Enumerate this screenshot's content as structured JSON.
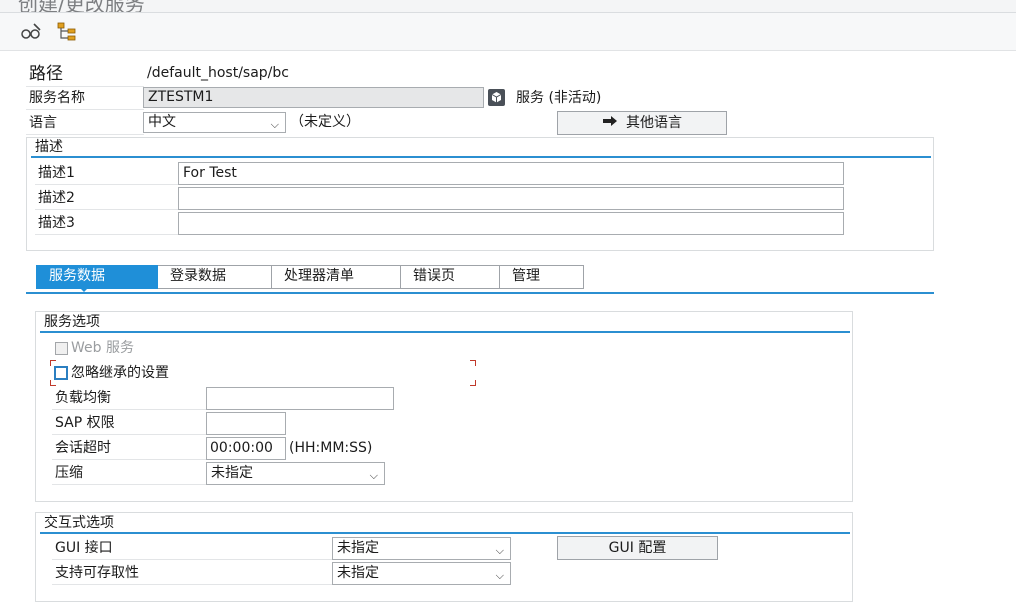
{
  "window": {
    "title": "创建/更改服务"
  },
  "toolbar": {
    "icons": [
      "glasses-edit-icon",
      "hierarchy-icon"
    ]
  },
  "header": {
    "path_label": "路径",
    "path_value": "/default_host/sap/bc",
    "service_name_label": "服务名称",
    "service_name_value": "ZTESTM1",
    "service_status": "服务 (非活动)",
    "language_label": "语言",
    "language_value": "中文",
    "language_undefined": "（未定义）",
    "other_languages_button": "其他语言"
  },
  "description": {
    "title": "描述",
    "rows": [
      {
        "label": "描述1",
        "value": "For Test"
      },
      {
        "label": "描述2",
        "value": ""
      },
      {
        "label": "描述3",
        "value": ""
      }
    ]
  },
  "tabs": [
    {
      "label": "服务数据",
      "active": true
    },
    {
      "label": "登录数据",
      "active": false
    },
    {
      "label": "处理器清单",
      "active": false
    },
    {
      "label": "错误页",
      "active": false
    },
    {
      "label": "管理",
      "active": false
    }
  ],
  "service_options": {
    "title": "服务选项",
    "web_service_label": "Web 服务",
    "ignore_inherit_label": "忽略继承的设置",
    "load_balance_label": "负载均衡",
    "load_balance_value": "",
    "sap_auth_label": "SAP 权限",
    "sap_auth_value": "",
    "session_timeout_label": "会话超时",
    "session_timeout_value": "00:00:00",
    "session_timeout_unit": "(HH:MM:SS)",
    "compression_label": "压缩",
    "compression_value": "未指定"
  },
  "interactive_options": {
    "title": "交互式选项",
    "gui_interface_label": "GUI 接口",
    "gui_interface_value": "未指定",
    "accessibility_label": "支持可存取性",
    "accessibility_value": "未指定",
    "gui_config_button": "GUI 配置"
  },
  "colors": {
    "accent": "#1f8fd8",
    "rule": "#2b8fd1"
  }
}
